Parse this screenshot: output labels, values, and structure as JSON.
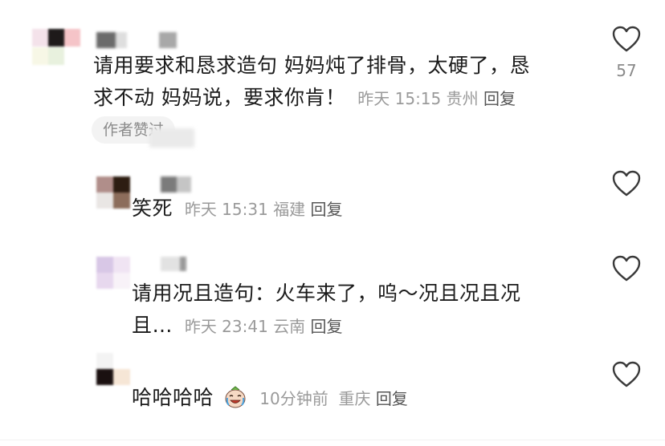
{
  "comments": [
    {
      "text_line1": "请用要求和恳求造句 妈妈炖了排骨，太硬了，恳",
      "text_line2": "求不动 妈妈说，要求你肯！",
      "time": "昨天 15:15",
      "location": "贵州",
      "reply": "回复",
      "badge": "作者赞过",
      "likes": "57",
      "heart_icon": "heart-outline-icon"
    },
    {
      "text_line1": "笑死",
      "time": "昨天 15:31",
      "location": "福建",
      "reply": "回复",
      "heart_icon": "heart-outline-icon"
    },
    {
      "text_line1": "请用况且造句：火车来了，呜～况且况且况",
      "text_line2": "且…",
      "time": "昨天 23:41",
      "location": "云南",
      "reply": "回复",
      "heart_icon": "heart-outline-icon"
    },
    {
      "text_line1": "哈哈哈哈",
      "emoji": "laughing-crying-sticker",
      "time": "10分钟前",
      "location": "重庆",
      "reply": "回复",
      "heart_icon": "heart-outline-icon"
    }
  ]
}
